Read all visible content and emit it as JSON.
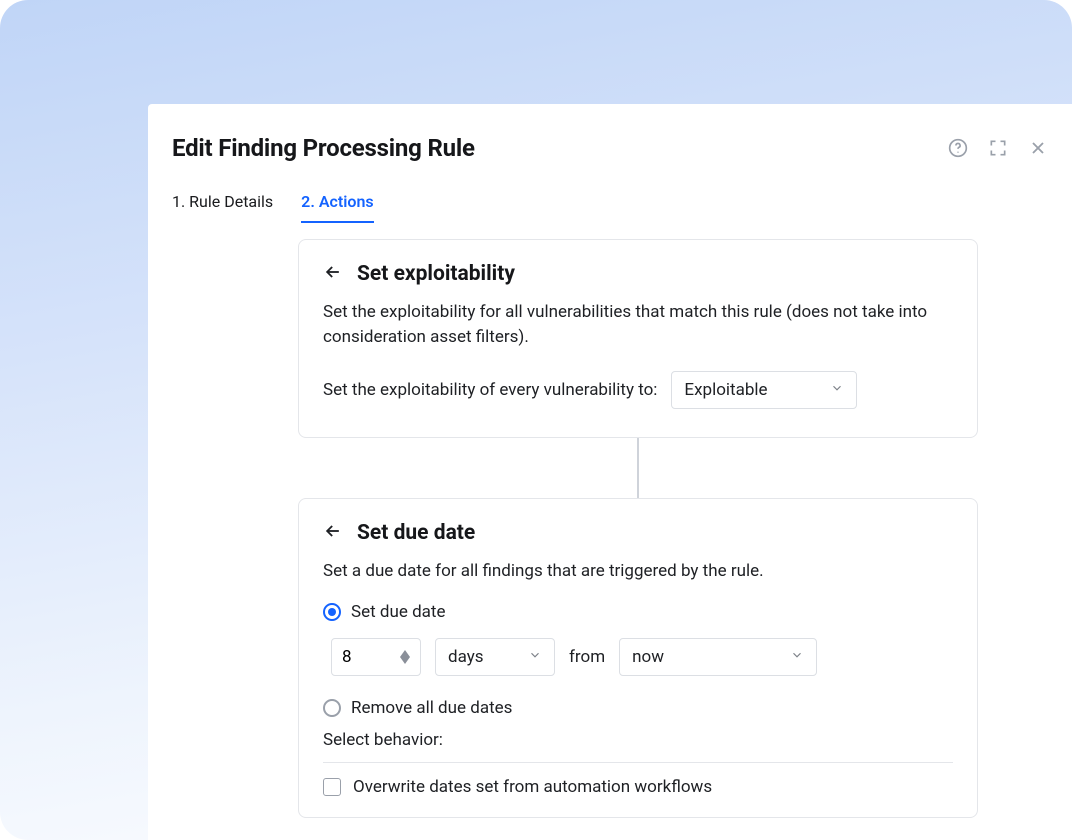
{
  "header": {
    "title": "Edit Finding Processing Rule"
  },
  "tabs": {
    "t1": "1. Rule Details",
    "t2": "2. Actions"
  },
  "card1": {
    "title": "Set exploitability",
    "desc": "Set the exploitability for all vulnerabilities that match this rule (does not take into consideration asset filters).",
    "prompt": "Set the exploitability of every vulnerability to:",
    "select_value": "Exploitable"
  },
  "card2": {
    "title": "Set due date",
    "desc": "Set a due date for all findings that are triggered by the rule.",
    "radio_set": "Set due date",
    "num_value": "8",
    "unit_value": "days",
    "from_label": "from",
    "from_value": "now",
    "radio_remove": "Remove all due dates",
    "behavior_label": "Select behavior:",
    "check_overwrite": "Overwrite dates set from automation workflows"
  }
}
